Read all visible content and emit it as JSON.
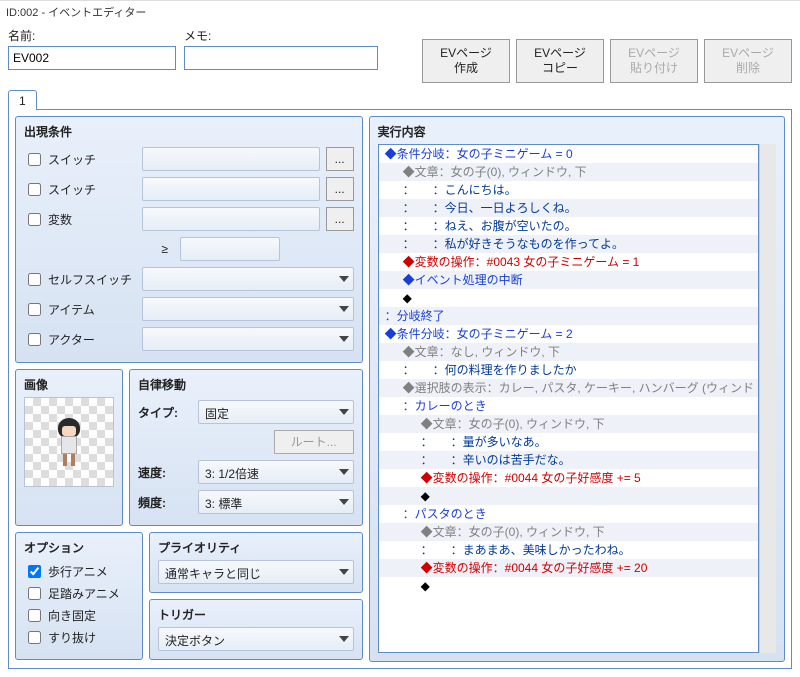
{
  "window_title": "ID:002 - イベントエディター",
  "fields": {
    "name_label": "名前:",
    "name_value": "EV002",
    "memo_label": "メモ:",
    "memo_value": ""
  },
  "buttons": {
    "create_l1": "EVページ",
    "create_l2": "作成",
    "copy_l1": "EVページ",
    "copy_l2": "コピー",
    "paste_l1": "EVページ",
    "paste_l2": "貼り付け",
    "delete_l1": "EVページ",
    "delete_l2": "削除"
  },
  "tab1": "1",
  "conditions": {
    "title": "出現条件",
    "switch": "スイッチ",
    "variable": "変数",
    "ge": "≥",
    "self_switch": "セルフスイッチ",
    "item": "アイテム",
    "actor": "アクター",
    "dots": "..."
  },
  "image": {
    "title": "画像"
  },
  "autonomous": {
    "title": "自律移動",
    "type_label": "タイプ:",
    "type_value": "固定",
    "route_button": "ルート...",
    "speed_label": "速度:",
    "speed_value": "3: 1/2倍速",
    "freq_label": "頻度:",
    "freq_value": "3: 標準"
  },
  "options": {
    "title": "オプション",
    "walk_anime": "歩行アニメ",
    "step_anime": "足踏みアニメ",
    "dir_fix": "向き固定",
    "through": "すり抜け"
  },
  "priority": {
    "title": "プライオリティ",
    "value": "通常キャラと同じ"
  },
  "trigger": {
    "title": "トリガー",
    "value": "決定ボタン"
  },
  "exec": {
    "title": "実行内容",
    "lines": [
      {
        "d": 0,
        "c": "blue",
        "t": "◆条件分岐：女の子ミニゲーム = 0"
      },
      {
        "d": 1,
        "c": "grey",
        "t": "◆文章：女の子(0), ウィンドウ, 下"
      },
      {
        "d": 1,
        "c": "navy",
        "t": "：　　：こんにちは。"
      },
      {
        "d": 1,
        "c": "navy",
        "t": "：　　：今日、一日よろしくね。"
      },
      {
        "d": 1,
        "c": "navy",
        "t": "：　　：ねえ、お腹が空いたの。"
      },
      {
        "d": 1,
        "c": "navy",
        "t": "：　　：私が好きそうなものを作ってよ。"
      },
      {
        "d": 1,
        "c": "red",
        "t": "◆変数の操作：#0043 女の子ミニゲーム = 1"
      },
      {
        "d": 1,
        "c": "blue",
        "t": "◆イベント処理の中断"
      },
      {
        "d": 1,
        "c": "black",
        "t": "◆"
      },
      {
        "d": 0,
        "c": "blue",
        "t": "：分岐終了"
      },
      {
        "d": 0,
        "c": "blue",
        "t": "◆条件分岐：女の子ミニゲーム = 2"
      },
      {
        "d": 1,
        "c": "grey",
        "t": "◆文章：なし, ウィンドウ, 下"
      },
      {
        "d": 1,
        "c": "navy",
        "t": "：　　：何の料理を作りましたか"
      },
      {
        "d": 1,
        "c": "grey",
        "t": "◆選択肢の表示：カレー, パスタ, ケーキー, ハンバーグ (ウィンド"
      },
      {
        "d": 1,
        "c": "blue",
        "t": "：カレーのとき"
      },
      {
        "d": 2,
        "c": "grey",
        "t": "◆文章：女の子(0), ウィンドウ, 下"
      },
      {
        "d": 2,
        "c": "navy",
        "t": "：　　：量が多いなあ。"
      },
      {
        "d": 2,
        "c": "navy",
        "t": "：　　：辛いのは苦手だな。"
      },
      {
        "d": 2,
        "c": "red",
        "t": "◆変数の操作：#0044 女の子好感度 += 5"
      },
      {
        "d": 2,
        "c": "black",
        "t": "◆"
      },
      {
        "d": 1,
        "c": "blue",
        "t": "：パスタのとき"
      },
      {
        "d": 2,
        "c": "grey",
        "t": "◆文章：女の子(0), ウィンドウ, 下"
      },
      {
        "d": 2,
        "c": "navy",
        "t": "：　　：まあまあ、美味しかったわね。"
      },
      {
        "d": 2,
        "c": "red",
        "t": "◆変数の操作：#0044 女の子好感度 += 20"
      },
      {
        "d": 2,
        "c": "black",
        "t": "◆"
      }
    ]
  }
}
